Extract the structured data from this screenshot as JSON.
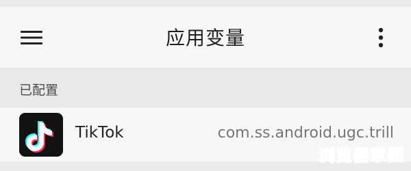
{
  "header": {
    "title": "应用变量",
    "menu_icon": "hamburger-menu-icon",
    "more_icon": "vertical-ellipsis-icon"
  },
  "section": {
    "label": "已配置"
  },
  "apps": [
    {
      "name": "TikTok",
      "package": "com.ss.android.ugc.trill",
      "icon": "tiktok-logo-icon"
    }
  ],
  "watermark": {
    "text": "浏览器家园",
    "color": "#20c997"
  },
  "colors": {
    "app_bar_bg": "#f7f7f7",
    "section_bg": "#e9e9e9",
    "title_text": "#202020",
    "package_text": "#767676"
  }
}
